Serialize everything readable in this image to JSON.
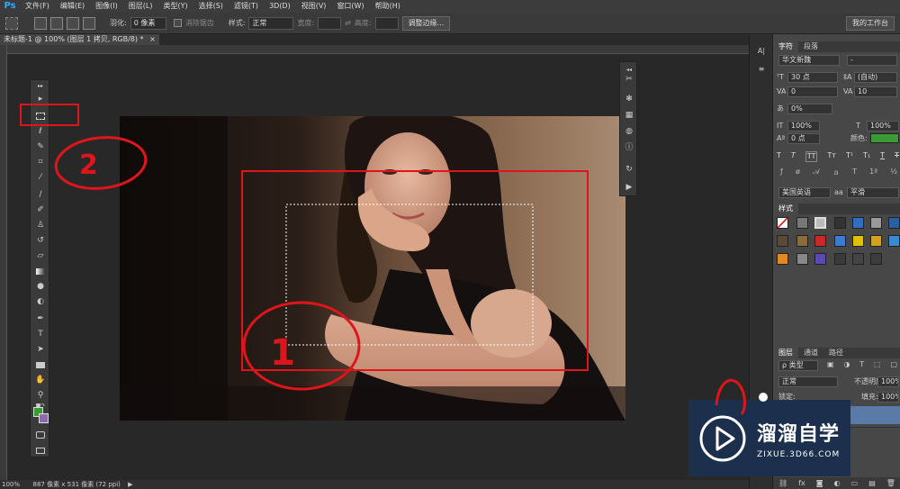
{
  "app": {
    "logo": "Ps"
  },
  "menu": [
    "文件(F)",
    "编辑(E)",
    "图像(I)",
    "图层(L)",
    "类型(Y)",
    "选择(S)",
    "滤镜(T)",
    "3D(D)",
    "视图(V)",
    "窗口(W)",
    "帮助(H)"
  ],
  "options": {
    "feather_label": "羽化:",
    "feather_value": "0 像素",
    "antialias_label": "消除锯齿",
    "style_label": "样式:",
    "style_value": "正常",
    "width_label": "宽度:",
    "height_label": "高度:",
    "refine_edge_button": "调整边缘...",
    "workspace_button": "我的工作台"
  },
  "document": {
    "tab": "未标题-1 @ 100% (图层 1 拷贝, RGB/8) *",
    "close": "×"
  },
  "status": {
    "zoom": "100%",
    "info": "887 像素 x 531 像素 (72 ppi)"
  },
  "character_panel": {
    "tabs": [
      "字符",
      "段落"
    ],
    "font_family": "华文新魏",
    "font_style": "-",
    "font_size": "30 点",
    "leading": "(自动)",
    "kerning": "0",
    "tracking": "10",
    "scale_tsume": "0%",
    "vertical_scale": "100%",
    "horizontal_scale": "100%",
    "baseline_shift": "0 点",
    "color_label": "颜色:",
    "color": "#3b9a35",
    "type_buttons": [
      "T",
      "T",
      "TT",
      "Tт",
      "T¹",
      "T₁",
      "T",
      "T"
    ],
    "language": "美国英语",
    "aa_label": "aa",
    "antialias": "平滑"
  },
  "styles_panel": {
    "title": "样式"
  },
  "layers_panel": {
    "tabs": [
      "图层",
      "通道",
      "路径"
    ],
    "filter": "ρ 类型",
    "blend_mode": "正常",
    "opacity_label": "不透明度:",
    "opacity": "100%",
    "fill_label": "填充:",
    "fill": "100%",
    "lock_label": "锁定:"
  },
  "annotations": {
    "circle_one": "1",
    "circle_two": "2"
  },
  "watermark": {
    "name": "溜溜自学",
    "url": "ZIXUE.3D66.COM"
  },
  "colors": {
    "accent": "#31a8ff",
    "annotation_red": "#e0151b",
    "watermark_bg": "#1c2f4d"
  }
}
